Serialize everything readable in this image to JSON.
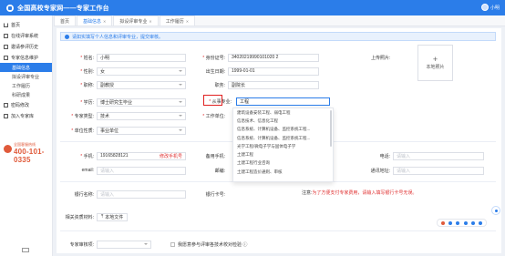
{
  "app": {
    "title": "全国高校专家网——专家工作台",
    "user_label": "小明"
  },
  "sidebar": {
    "items": [
      {
        "label": "首页",
        "icon": "home-icon"
      },
      {
        "label": "在线评审系统",
        "icon": "document-icon"
      },
      {
        "label": "邀请参评历史",
        "icon": "history-icon"
      },
      {
        "label": "专家信息维护",
        "icon": "user-icon"
      }
    ],
    "subitems": [
      {
        "label": "基础信息",
        "active": true
      },
      {
        "label": "拟设评审专业",
        "active": false
      },
      {
        "label": "工作履历",
        "active": false
      },
      {
        "label": "科研成果",
        "active": false
      }
    ],
    "bottom_items": [
      {
        "label": "密码修改",
        "icon": "lock-icon"
      },
      {
        "label": "加入专家库",
        "icon": "add-user-icon"
      }
    ],
    "hotline_label": "全国客服热线",
    "hotline_number": "400-101-0335"
  },
  "tabs": [
    {
      "label": "首页",
      "closable": false
    },
    {
      "label": "基础信息",
      "closable": true
    },
    {
      "label": "拟设评审专业",
      "closable": true
    },
    {
      "label": "工作履历",
      "closable": true
    }
  ],
  "notice": {
    "text": "请如实填写个人信息和评审专业，提交审核。"
  },
  "form": {
    "name": {
      "label": "姓名:",
      "value": "小明"
    },
    "id_number": {
      "label": "身份证号:",
      "value": "34020219990101020 2"
    },
    "photo": {
      "label": "上传照片:",
      "upload_text": "本地照片",
      "plus": "+"
    },
    "gender": {
      "label": "性别:",
      "value": "女"
    },
    "birth_date": {
      "label": "出生日期:",
      "value": "1999-01-01"
    },
    "position": {
      "label": "职称:",
      "value": "副教授"
    },
    "job": {
      "label": "职务:",
      "value": "副院长"
    },
    "education": {
      "label": "学历:",
      "value": "博士研究生毕业"
    },
    "major": {
      "label": "从事专业:",
      "value": "工程"
    },
    "expert_type": {
      "label": "专家类型:",
      "value": "技术"
    },
    "work_unit": {
      "label": "工作单位:",
      "value": ""
    },
    "unit_nature": {
      "label": "单位性质:",
      "value": "事业单位"
    },
    "mobile": {
      "label": "手机:",
      "value": "19165828121",
      "action": "修改手机号"
    },
    "backup_mobile": {
      "label": "备用手机:",
      "placeholder": ""
    },
    "phone": {
      "label": "电话:",
      "placeholder": "请输入"
    },
    "email": {
      "label": "email:",
      "placeholder": "请输入"
    },
    "postcode": {
      "label": "邮编:",
      "placeholder": ""
    },
    "address": {
      "label": "通讯地址:",
      "placeholder": "请输入"
    },
    "bank": {
      "label": "银行名称:",
      "placeholder": "请输入"
    },
    "bank_card": {
      "label": "银行卡号:",
      "placeholder": "请输入"
    },
    "note": {
      "prefix": "注意:",
      "text": "为了方便支付专家费用，请输入填写银行卡号无误。"
    },
    "attachment": {
      "label": "相关资质材料:",
      "button": "本地文件"
    },
    "hidden_fields": {
      "label": "专家审核项:",
      "placeholder": ""
    },
    "agree": {
      "label": "我愿意参与评审各技术校对检验 ⓘ"
    }
  },
  "dropdown": {
    "items": [
      "建筑设备安装工程、弱电工程",
      "信息技术、信息化工程",
      "信息系统、计算机设备、监控系统工程...",
      "信息系统、计算机设备、监控系统工程...",
      "光学工程/微电子学与固体电子学",
      "土建工程",
      "土建工程行业咨询",
      "土建工程造价通则、审核"
    ]
  },
  "colors": {
    "brand": "#2b7de9",
    "danger": "#e03030",
    "hotline": "#e05a3a"
  }
}
